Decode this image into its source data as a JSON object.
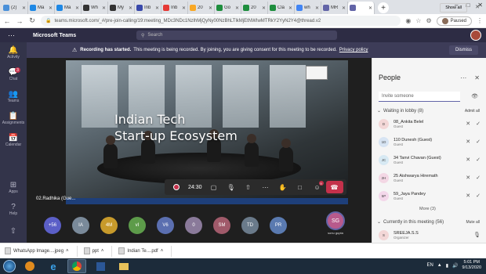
{
  "browser": {
    "tabs": [
      {
        "label": "(2)",
        "color": "#4a90d9"
      },
      {
        "label": "Ma",
        "color": "#1e88e5"
      },
      {
        "label": "Ma",
        "color": "#1e88e5"
      },
      {
        "label": "Wh",
        "color": "#333333"
      },
      {
        "label": "My",
        "color": "#333333"
      },
      {
        "label": "Inb",
        "color": "#3949ab"
      },
      {
        "label": "Inb",
        "color": "#e53935"
      },
      {
        "label": "20",
        "color": "#f9a825"
      },
      {
        "label": "Go",
        "color": "#1e8e3e"
      },
      {
        "label": "20",
        "color": "#1e8e3e"
      },
      {
        "label": "Cla",
        "color": "#1e8e3e"
      },
      {
        "label": "wh",
        "color": "#4285f4"
      },
      {
        "label": "MR",
        "color": "#6264a7"
      }
    ],
    "active_tab": {
      "label": "",
      "color": "#6264a7"
    },
    "url": "teams.microsoft.com/_#/pre-join-calling/19:meeting_MDc3NDc1NzlhMjQyNy00NzBhLTlkMjEtNWIwMTRkY2YyN2Y4@thread.v2",
    "profile_status": "Paused"
  },
  "teams": {
    "app_name": "Microsoft Teams",
    "search_placeholder": "Search"
  },
  "rail": [
    {
      "icon": "bell-icon",
      "label": "Activity",
      "badge": ""
    },
    {
      "icon": "chat-icon",
      "label": "Chat",
      "badge": "3"
    },
    {
      "icon": "teams-icon",
      "label": "Teams",
      "badge": ""
    },
    {
      "icon": "assignments-icon",
      "label": "Assignments",
      "badge": ""
    },
    {
      "icon": "calendar-icon",
      "label": "Calendar",
      "badge": ""
    }
  ],
  "rail_bottom": [
    {
      "icon": "apps-icon",
      "label": "Apps"
    },
    {
      "icon": "help-icon",
      "label": "Help"
    }
  ],
  "banner": {
    "bold": "Recording has started.",
    "text": "This meeting is being recorded. By joining, you are giving consent for this meeting to be recorded.",
    "link": "Privacy policy",
    "dismiss": "Dismiss"
  },
  "video": {
    "title_line1": "Indian Tech",
    "title_line2": "Start-up Ecosystem"
  },
  "controls": {
    "timer": "24:30",
    "share_badge": "9"
  },
  "speaker_label": "02.Radhika (Gue...",
  "participants": [
    {
      "initials": "+56",
      "color": "#5b5fc7"
    },
    {
      "initials": "IA",
      "color": "#7a8a9a"
    },
    {
      "initials": "4M",
      "color": "#c79a2b"
    },
    {
      "initials": "vI",
      "color": "#5d9b4a"
    },
    {
      "initials": "V6",
      "color": "#5b6fb0"
    },
    {
      "initials": "0",
      "color": "#8a7a9a"
    },
    {
      "initials": "SM",
      "color": "#a05a6a"
    },
    {
      "initials": "TD",
      "color": "#6a7a8a"
    },
    {
      "initials": "PR",
      "color": "#5a7ab0"
    }
  ],
  "presenter": {
    "initials": "SG",
    "name": "sonu gupta"
  },
  "people": {
    "title": "People",
    "invite_placeholder": "Invite someone",
    "lobby_header": "Waiting in lobby (8)",
    "admit_all": "Admit all",
    "lobby": [
      {
        "initials": "D",
        "name": "08_Ankita Belel",
        "role": "Guest",
        "color": "#f3d7d7"
      },
      {
        "initials": "1D",
        "name": "110 Dunesh (Guest)",
        "role": "Guest",
        "color": "#d7e4f3"
      },
      {
        "initials": "JC",
        "name": "34 Tanvi Chavan (Guest)",
        "role": "Guest",
        "color": "#d7e9f3"
      },
      {
        "initials": "2H",
        "name": "25 Aishwarya Hiremath",
        "role": "Guest",
        "color": "#f3d7e4"
      },
      {
        "initials": "5P",
        "name": "59_Jaya Pandey",
        "role": "Guest",
        "color": "#f3d7ea"
      }
    ],
    "more": "More (3)",
    "meeting_header": "Currently in this meeting (56)",
    "mute_all": "Mute all",
    "meeting": [
      {
        "initials": "S",
        "name": "SREEJA.S.S",
        "role": "Organizer",
        "color": "#f3d7d7"
      }
    ]
  },
  "downloads": {
    "items": [
      "WhatsApp Image....jpeg",
      "ppt",
      "Indian Te....pdf"
    ],
    "show_all": "Show all"
  },
  "taskbar": {
    "lang": "EN",
    "time": "5:01 PM",
    "date": "9/13/2020"
  }
}
